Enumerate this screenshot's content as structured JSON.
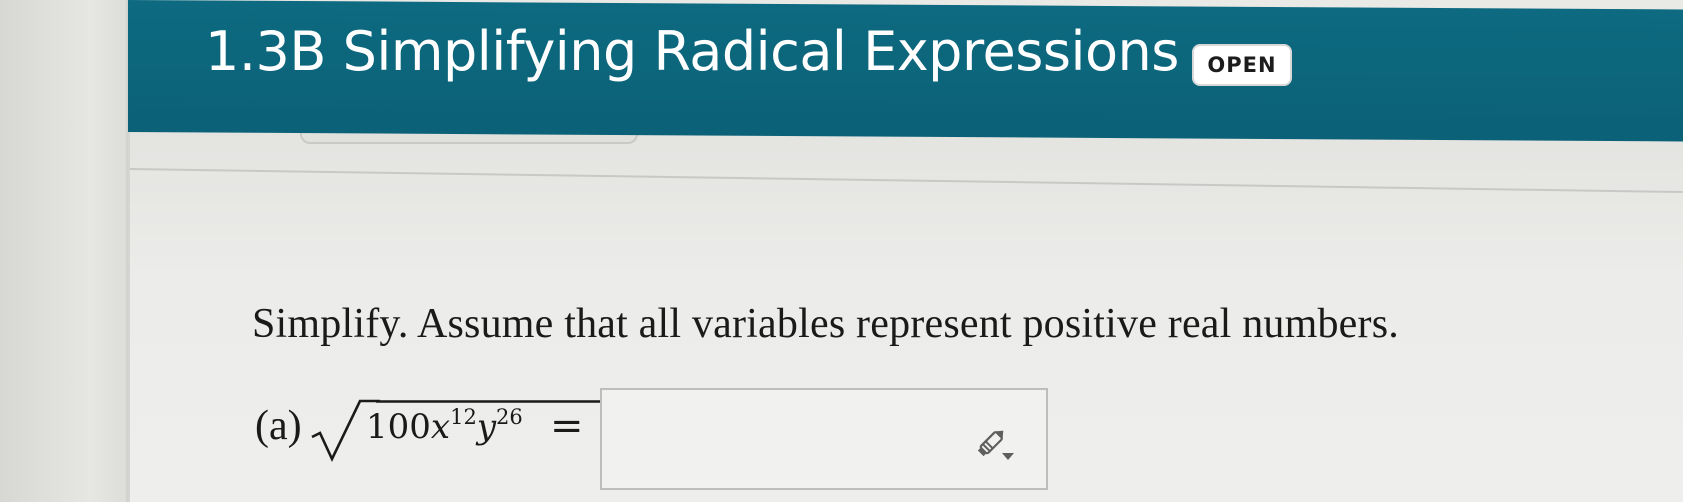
{
  "header": {
    "title": "1.3B Simplifying Radical Expressions",
    "badge": "OPEN",
    "background_color": "#0d6a80"
  },
  "question": {
    "instruction": "Simplify. Assume that all variables represent positive real numbers.",
    "parts": [
      {
        "label": "(a)",
        "expression": {
          "coefficient": "100",
          "var1": "x",
          "exp1": "12",
          "var2": "y",
          "exp2": "26"
        },
        "equals": "=",
        "answer_value": "",
        "tool_icon": "pencil-dropdown-icon"
      }
    ]
  }
}
